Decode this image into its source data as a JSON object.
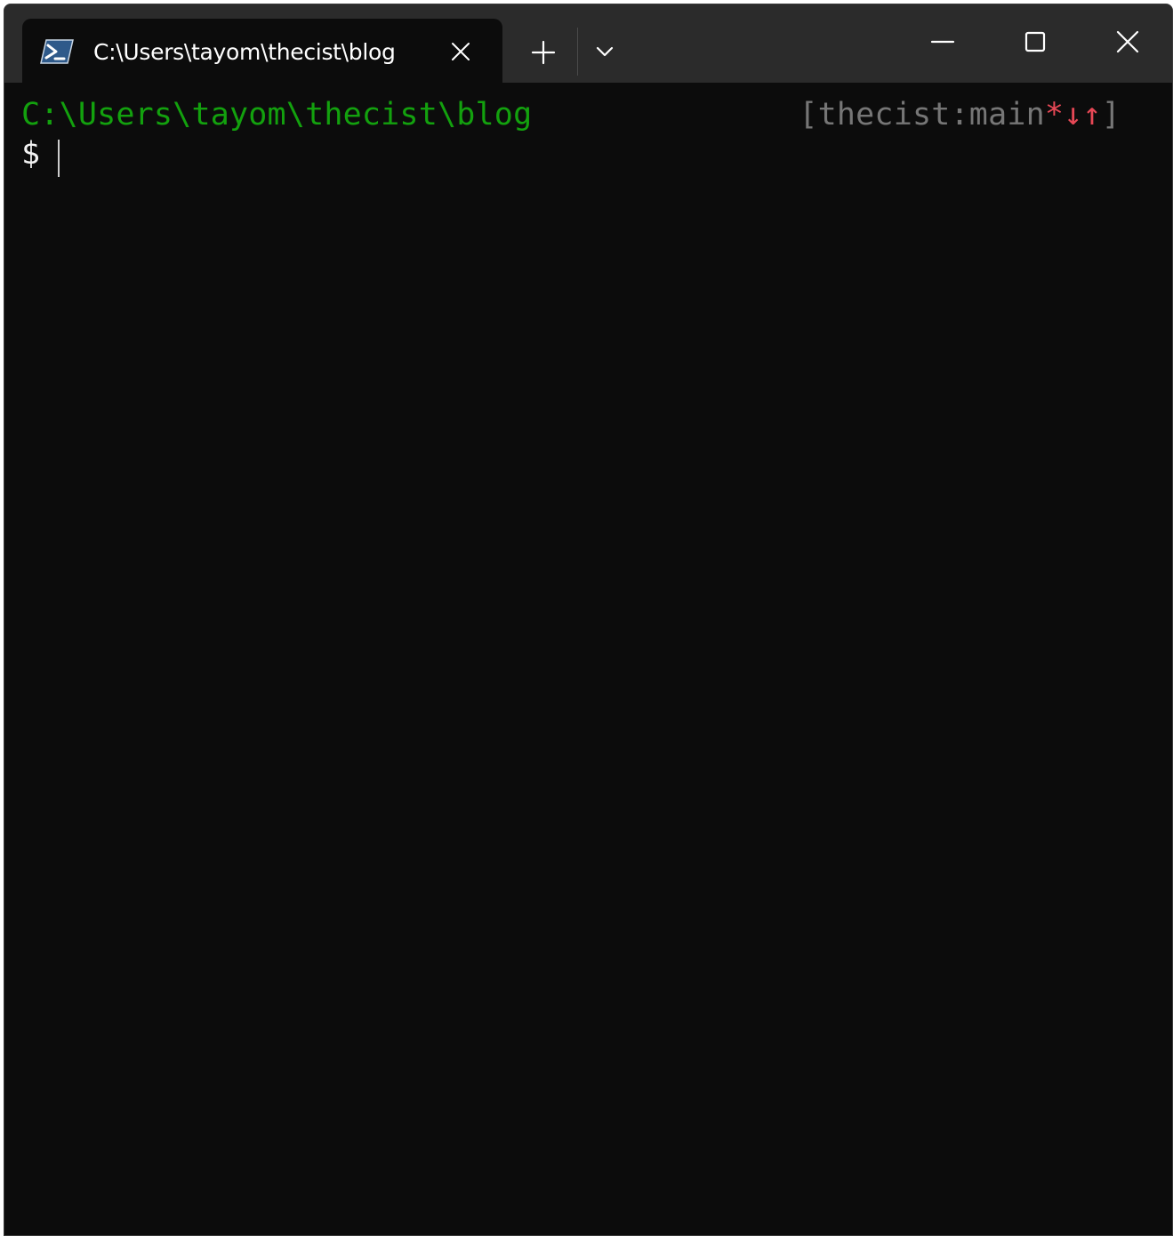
{
  "tab": {
    "title": "C:\\Users\\tayom\\thecist\\blog",
    "icon": "powershell-icon"
  },
  "titlebar_buttons": {
    "new_tab": "plus-icon",
    "dropdown": "chevron-down-icon",
    "minimize": "minimize-icon",
    "maximize": "maximize-icon",
    "close": "close-icon"
  },
  "terminal": {
    "cwd": "C:\\Users\\tayom\\thecist\\blog",
    "git": {
      "open_bracket": "[",
      "repo": "thecist",
      "separator": ":",
      "branch": "main",
      "marks": "*↓↑",
      "close_bracket": "]"
    },
    "prompt": "$"
  },
  "colors": {
    "background": "#0c0c0c",
    "titlebar": "#2b2b2b",
    "cwd_green": "#13a10e",
    "git_gray": "#767676",
    "git_red": "#e74856"
  }
}
